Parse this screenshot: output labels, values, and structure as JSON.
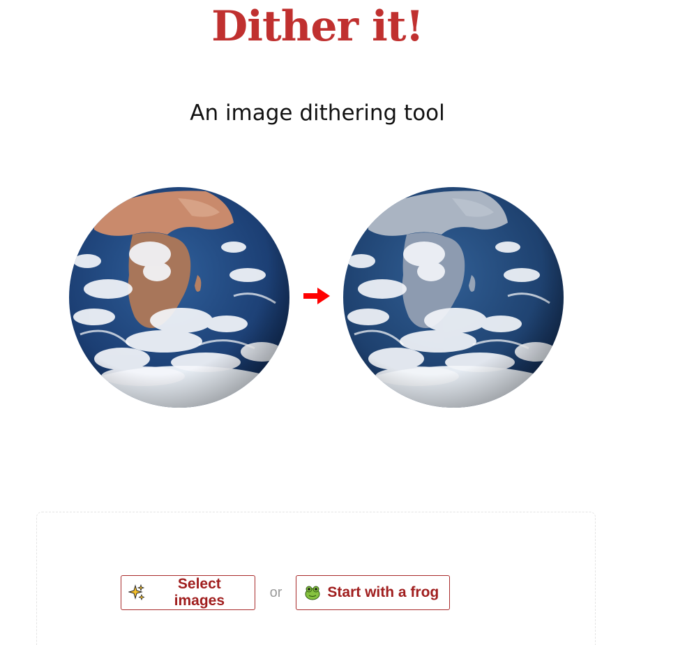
{
  "header": {
    "title": "Dither it!",
    "subtitle": "An image dithering tool"
  },
  "hero": {
    "original_image": "earth-globe-color",
    "dithered_image": "earth-globe-dithered",
    "arrow_icon": "right-arrow-icon",
    "arrow_color": "#ff0000"
  },
  "actions": {
    "select_label": "Select images",
    "select_icon": "sparkles-icon",
    "or_label": "or",
    "frog_label": "Start with a frog",
    "frog_icon": "frog-icon"
  },
  "colors": {
    "title": "#c0302f",
    "button_text": "#a01e1e",
    "button_border": "#a82a2a"
  }
}
